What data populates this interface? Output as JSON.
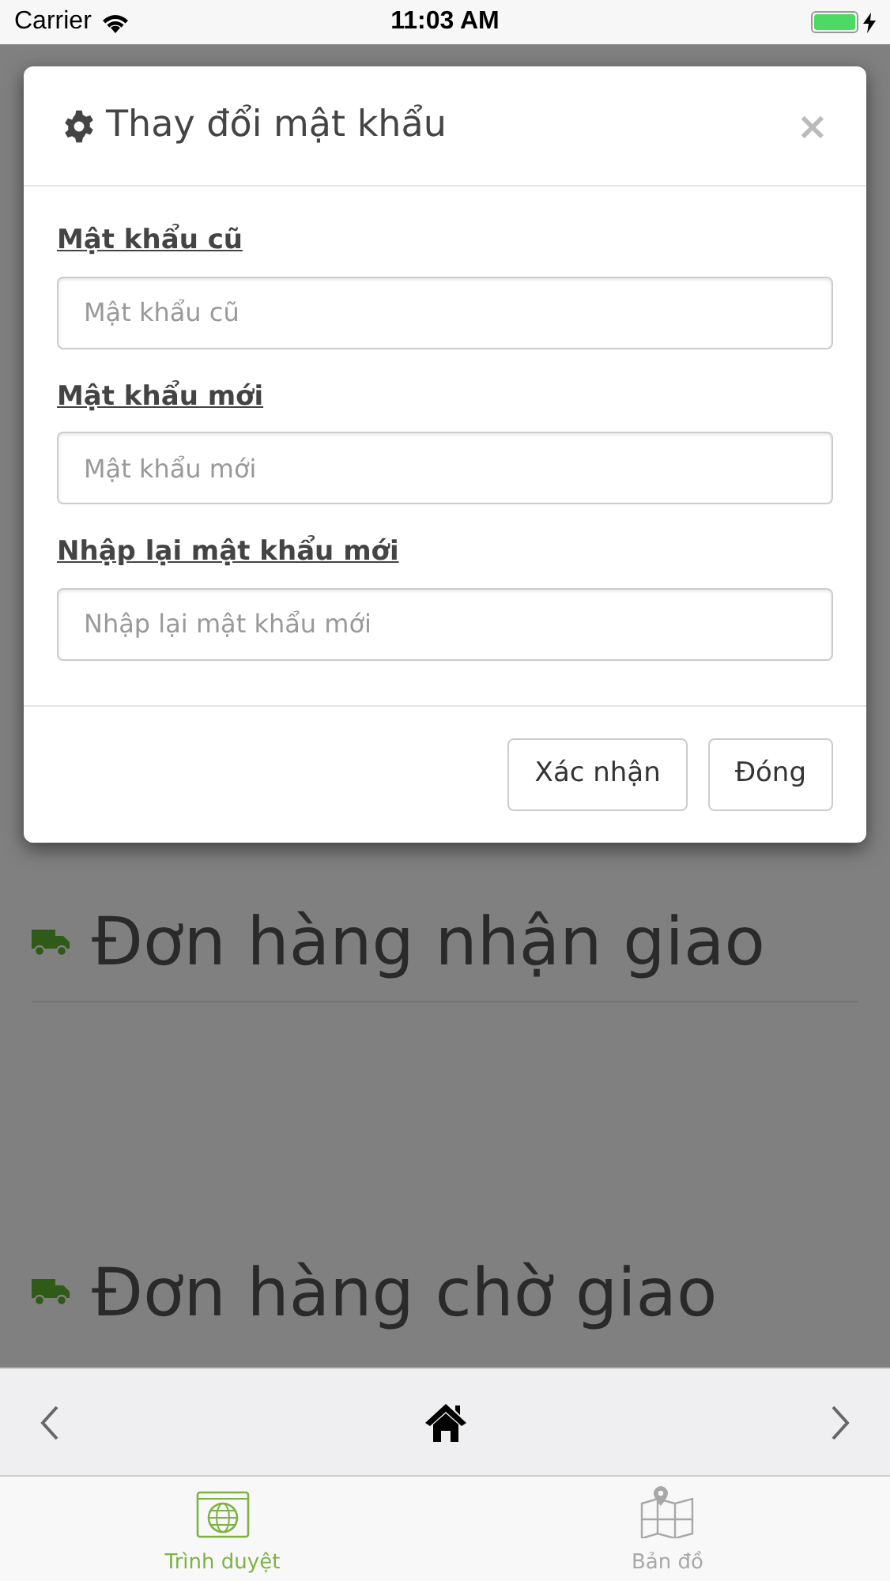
{
  "status_bar": {
    "carrier": "Carrier",
    "time": "11:03 AM"
  },
  "page_items": [
    {
      "title": "Đơn hàng nhận giao"
    },
    {
      "title": "Đơn hàng chờ giao"
    }
  ],
  "dialog": {
    "title": "Thay đổi mật khẩu",
    "close": "×",
    "fields": [
      {
        "label": "Mật khẩu cũ",
        "placeholder": "Mật khẩu cũ"
      },
      {
        "label": "Mật khẩu mới",
        "placeholder": "Mật khẩu mới"
      },
      {
        "label": "Nhập lại mật khẩu mới",
        "placeholder": "Nhập lại mật khẩu mới"
      }
    ],
    "buttons": [
      "Xác nhận",
      "Đóng"
    ]
  },
  "tabs": [
    {
      "label": "Trình duyệt",
      "kind": "browser",
      "selected": true
    },
    {
      "label": "Bản đồ",
      "kind": "map",
      "selected": false
    }
  ]
}
